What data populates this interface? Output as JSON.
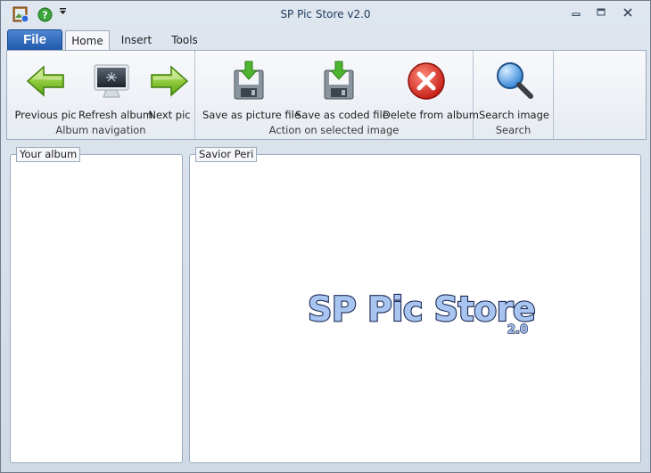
{
  "window": {
    "title": "SP Pic Store v2.0"
  },
  "quick_access": {
    "app_icon": "app-picture-icon",
    "help_icon": "help-icon",
    "dropdown_icon": "chevron-down-icon"
  },
  "window_controls": {
    "minimize_icon": "minimize-icon",
    "maximize_icon": "maximize-icon",
    "close_icon": "close-icon"
  },
  "tabs": {
    "file": "File",
    "items": [
      {
        "label": "Home",
        "active": true
      },
      {
        "label": "Insert",
        "active": false
      },
      {
        "label": "Tools",
        "active": false
      }
    ]
  },
  "ribbon": {
    "groups": [
      {
        "label": "Album navigation",
        "buttons": [
          {
            "label": "Previous pic",
            "icon": "arrow-left-icon"
          },
          {
            "label": "Refresh album",
            "icon": "monitor-icon"
          },
          {
            "label": "Next pic",
            "icon": "arrow-right-icon"
          }
        ]
      },
      {
        "label": "Action on selected image",
        "buttons": [
          {
            "label": "Save as picture file",
            "icon": "save-disk-icon"
          },
          {
            "label": "Save as coded file",
            "icon": "save-disk-icon"
          },
          {
            "label": "Delete from album",
            "icon": "delete-x-icon"
          }
        ]
      },
      {
        "label": "Search",
        "buttons": [
          {
            "label": "Search image",
            "icon": "magnifier-icon"
          }
        ]
      }
    ]
  },
  "panels": {
    "album": {
      "title": "Your album"
    },
    "viewer": {
      "title": "Savior Peri",
      "logo_text": "SP Pic Store",
      "logo_version": "2.0"
    }
  },
  "colors": {
    "file_tab": "#2b63b5",
    "window_bg": "#d6dee9",
    "logo_fill": "#a8c4f0",
    "logo_outline": "#1b2a55"
  }
}
